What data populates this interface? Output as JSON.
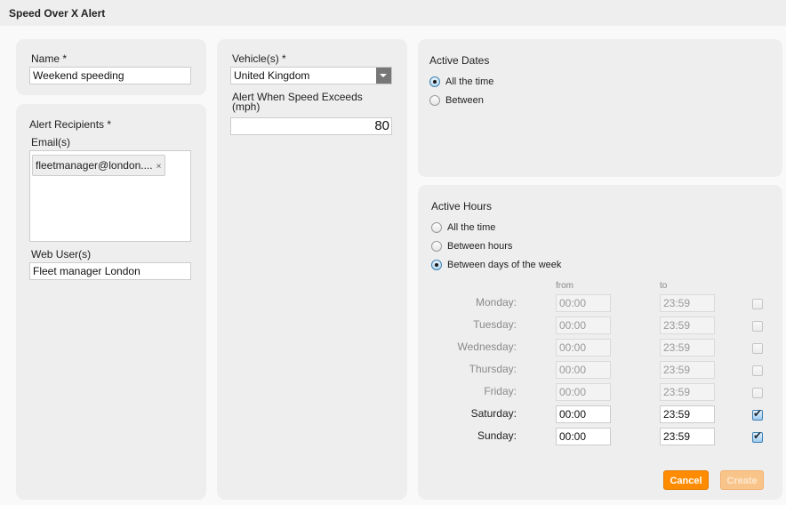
{
  "header": {
    "title": "Speed Over X Alert"
  },
  "name_panel": {
    "label": "Name *",
    "value": "Weekend speeding"
  },
  "recipients_panel": {
    "title": "Alert Recipients *",
    "emails_label": "Email(s)",
    "emails": [
      {
        "text": "fleetmanager@london....",
        "remove_glyph": "×"
      }
    ],
    "web_users_label": "Web User(s)",
    "web_users_value": "Fleet manager London"
  },
  "vehicle_panel": {
    "vehicles_label": "Vehicle(s) *",
    "vehicles_selected": "United Kingdom",
    "dropdown_icon": "chevron-down-icon",
    "speed_label_line1": "Alert When Speed Exceeds",
    "speed_label_line2": "(mph)",
    "speed_value": "80"
  },
  "active_dates": {
    "title": "Active Dates",
    "options": [
      {
        "label": "All the time",
        "checked": true
      },
      {
        "label": "Between",
        "checked": false
      }
    ]
  },
  "active_hours": {
    "title": "Active Hours",
    "options": [
      {
        "label": "All the time",
        "checked": false
      },
      {
        "label": "Between hours",
        "checked": false
      },
      {
        "label": "Between days of the week",
        "checked": true
      }
    ],
    "from_header": "from",
    "to_header": "to",
    "days": [
      {
        "label": "Monday:",
        "from": "00:00",
        "to": "23:59",
        "enabled": false
      },
      {
        "label": "Tuesday:",
        "from": "00:00",
        "to": "23:59",
        "enabled": false
      },
      {
        "label": "Wednesday:",
        "from": "00:00",
        "to": "23:59",
        "enabled": false
      },
      {
        "label": "Thursday:",
        "from": "00:00",
        "to": "23:59",
        "enabled": false
      },
      {
        "label": "Friday:",
        "from": "00:00",
        "to": "23:59",
        "enabled": false
      },
      {
        "label": "Saturday:",
        "from": "00:00",
        "to": "23:59",
        "enabled": true
      },
      {
        "label": "Sunday:",
        "from": "00:00",
        "to": "23:59",
        "enabled": true
      }
    ]
  },
  "actions": {
    "cancel_label": "Cancel",
    "create_label": "Create",
    "create_disabled": true,
    "accent_color": "#ff8c00"
  }
}
